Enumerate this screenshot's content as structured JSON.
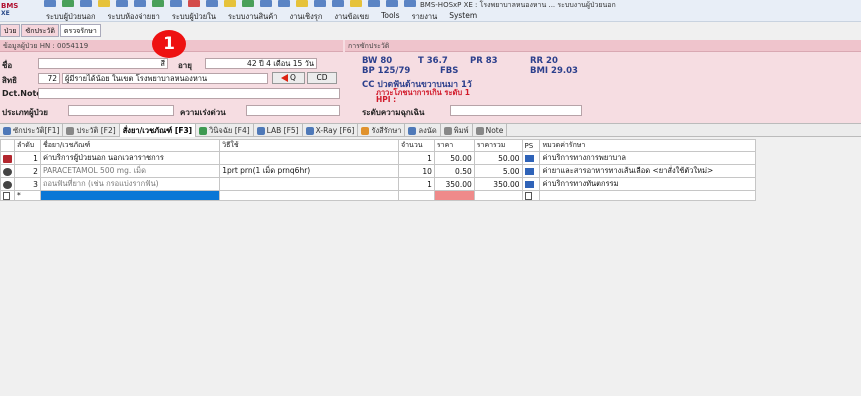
{
  "app": {
    "logo_text": "BMS",
    "title": "BMS-HOSxP XE : โรงพยาบาลหนองหาน ... ระบบงานผู้ป่วยนอก"
  },
  "menu": [
    "ระบบผู้ป่วยนอก",
    "ระบบห้องจ่ายยา",
    "ระบบผู้ป่วยใน",
    "ระบบงานสินค้า",
    "งานเชิงรุก",
    "งานข้อเขย",
    "Tools",
    "รายงาน",
    "System"
  ],
  "sub_tabs": [
    "ป่วย",
    "ซักประวัติ",
    "ตรวจรักษา"
  ],
  "badge": "1",
  "patient_panel": {
    "header": "ข้อมูลผู้ป่วย HN : 0054119",
    "name_label": "ชื่อ",
    "name_value": "สี",
    "age_label": "อายุ",
    "age_value": "42 ปี 4 เดือน 15 วัน",
    "right_label": "สิทธิ",
    "right_code": "72",
    "right_text": "ผู้มีรายได้น้อย ในเขต โรงพยาบาลหนองหาน",
    "btn_q": "Q",
    "btn_cd": "CD",
    "dct_label": "Dct.Note.",
    "ptype_label": "ประเภทผู้ป่วย",
    "urgent_label": "ความเร่งด่วน"
  },
  "history_panel": {
    "header": "การซักประวัติ",
    "bw": "BW 80",
    "t": "T 36.7",
    "pr": "PR 83",
    "rr": "RR 20",
    "bp": "BP 125/79",
    "fbs": "FBS",
    "bmi": "BMI 29.03",
    "cc": "CC  ปวดฟันด้านขวาบนมา 1วั",
    "cc2": "ภาวะโภชนาการเกิน ระดับ 1",
    "hpi": "HPI :",
    "severity_label": "ระดับความฉุกเฉิน"
  },
  "function_tabs": [
    "ซักประวัติ[F1]",
    "ประวัติ [F2]",
    "สั่งยา/เวชภัณฑ์ [F3]",
    "วินิจฉัย [F4]",
    "LAB [F5]",
    "X-Ray [F6]",
    "รังสีรักษา",
    "ลงนัด",
    "พิมพ์",
    "Note"
  ],
  "table": {
    "headers": [
      "ลำดับ",
      "ชื่อยา/เวชภัณฑ์",
      "วิธีใช้",
      "จำนวน",
      "ราคา",
      "ราคารวม",
      "PS",
      "หมวดค่ารักษา"
    ],
    "rows": [
      {
        "no": "1",
        "name": "ค่าบริการผู้ป่วยนอก นอกเวลาราชการ",
        "usage": "",
        "qty": "1",
        "price": "50.00",
        "total": "50.00",
        "category": "ค่าบริการทางการพยาบาล"
      },
      {
        "no": "2",
        "name": "PARACETAMOL 500 mg. เม็ด",
        "usage": "1prt prn(1 เม็ด prnq6hr)",
        "qty": "10",
        "price": "0.50",
        "total": "5.00",
        "category": "ค่ายาและสารอาหารทางเส้นเลือด <ยาสั่งใช้ตัวใหม่>"
      },
      {
        "no": "3",
        "name": "ถอนฟันที่ยาก (เช่น กรอแบ่งรากฟัน)",
        "usage": "",
        "qty": "1",
        "price": "350.00",
        "total": "350.00",
        "category": "ค่าบริการทางทันตกรรม"
      }
    ],
    "new_row_marker": "*"
  }
}
